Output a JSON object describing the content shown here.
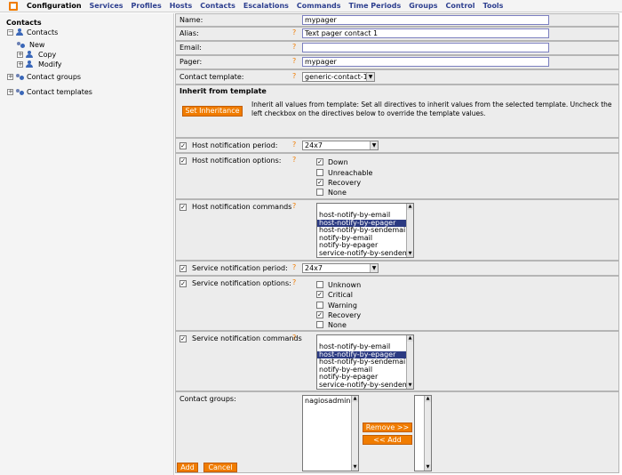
{
  "nav": {
    "items": [
      "Configuration",
      "Services",
      "Profiles",
      "Hosts",
      "Contacts",
      "Escalations",
      "Commands",
      "Time Periods",
      "Groups",
      "Control",
      "Tools"
    ]
  },
  "sidebar": {
    "title": "Contacts",
    "contacts": "Contacts",
    "new": "New",
    "copy": "Copy",
    "modify": "Modify",
    "contact_groups": "Contact groups",
    "contact_templates": "Contact templates"
  },
  "form": {
    "name_label": "Name:",
    "name_value": "mypager",
    "alias_label": "Alias:",
    "alias_value": "Text pager contact 1",
    "email_label": "Email:",
    "email_value": "",
    "pager_label": "Pager:",
    "pager_value": "mypager",
    "template_label": "Contact template:",
    "template_value": "generic-contact-1",
    "inherit_title": "Inherit from template",
    "set_inheritance": "Set Inheritance",
    "inherit_text": "Inherit all values from template: Set all directives to inherit values from the selected template. Uncheck the left checkbox on the directives below to override the template values.",
    "help": "?",
    "host_period_label": "Host notification period:",
    "host_period_value": "24x7",
    "host_options_label": "Host notification options:",
    "host_options": [
      {
        "label": "Down",
        "checked": true
      },
      {
        "label": "Unreachable",
        "checked": false
      },
      {
        "label": "Recovery",
        "checked": true
      },
      {
        "label": "None",
        "checked": false
      }
    ],
    "host_commands_label": "Host notification commands",
    "host_commands": [
      "host-notify-by-email",
      "host-notify-by-epager",
      "host-notify-by-sendemail",
      "notify-by-email",
      "notify-by-epager",
      "service-notify-by-sendemail"
    ],
    "service_period_label": "Service notification period:",
    "service_period_value": "24x7",
    "service_options_label": "Service notification options:",
    "service_options": [
      {
        "label": "Unknown",
        "checked": false
      },
      {
        "label": "Critical",
        "checked": true
      },
      {
        "label": "Warning",
        "checked": false
      },
      {
        "label": "Recovery",
        "checked": true
      },
      {
        "label": "None",
        "checked": false
      }
    ],
    "service_commands_label": "Service notification commands",
    "service_commands": [
      "host-notify-by-email",
      "host-notify-by-epager",
      "host-notify-by-sendemail",
      "notify-by-email",
      "notify-by-epager",
      "service-notify-by-sendemail"
    ],
    "contact_groups_label": "Contact groups:",
    "contact_groups_available": [
      "nagiosadmin"
    ],
    "remove_button": "Remove >>",
    "add_to_button": "<< Add",
    "add_button": "Add",
    "cancel_button": "Cancel"
  },
  "colors": {
    "accent": "#f07c00",
    "nav_text": "#2d3f8f",
    "selection": "#2b3a82"
  }
}
